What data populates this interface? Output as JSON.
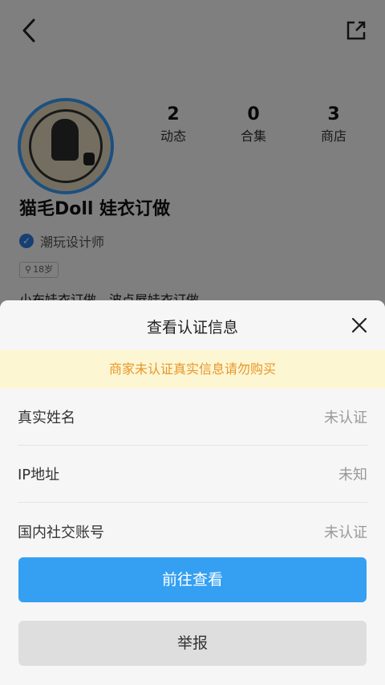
{
  "profile": {
    "name": "猫毛Doll 娃衣订做",
    "verification": "潮玩设计师",
    "age_tag": "18岁",
    "description": "小布娃衣订做，波点屋娃衣订做",
    "stats": [
      {
        "num": "2",
        "label": "动态"
      },
      {
        "num": "0",
        "label": "合集"
      },
      {
        "num": "3",
        "label": "商店"
      }
    ]
  },
  "sheet": {
    "title": "查看认证信息",
    "warning": "商家未认证真实信息请勿购买",
    "rows": [
      {
        "label": "真实姓名",
        "value": "未认证"
      },
      {
        "label": "IP地址",
        "value": "未知"
      },
      {
        "label": "国内社交账号",
        "value": "未认证"
      }
    ],
    "primary_button": "前往查看",
    "secondary_button": "举报"
  },
  "colors": {
    "primary": "#35a0f2",
    "warning_text": "#e8962b",
    "warning_bg": "#fdf6d2",
    "verify_blue": "#2f7fe6"
  }
}
